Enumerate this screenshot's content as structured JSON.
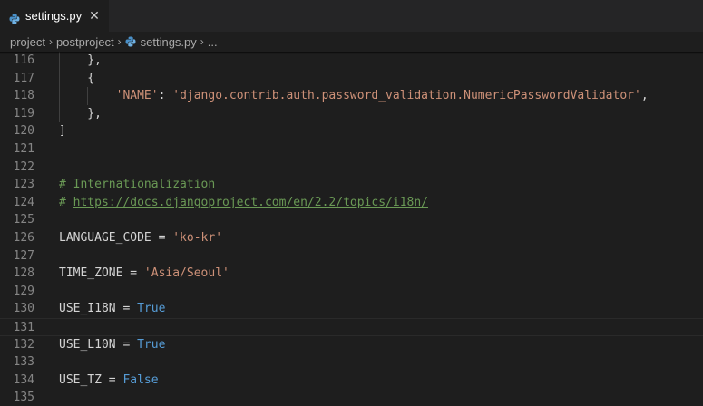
{
  "tab": {
    "label": "settings.py",
    "close": "✕",
    "icon": "python-file-icon"
  },
  "breadcrumb": {
    "items": [
      "project",
      "postproject",
      "settings.py",
      "..."
    ],
    "separator": "›"
  },
  "editor": {
    "lines": [
      {
        "num": "116",
        "tokens": [
          {
            "t": "    },",
            "c": ""
          }
        ],
        "guides": 1
      },
      {
        "num": "117",
        "tokens": [
          {
            "t": "    {",
            "c": ""
          }
        ],
        "guides": 1
      },
      {
        "num": "118",
        "tokens": [
          {
            "t": "        ",
            "c": ""
          },
          {
            "t": "'NAME'",
            "c": "t-str"
          },
          {
            "t": ": ",
            "c": ""
          },
          {
            "t": "'django.contrib.auth.password_validation.NumericPasswordValidator'",
            "c": "t-str"
          },
          {
            "t": ",",
            "c": ""
          }
        ],
        "guides": 2
      },
      {
        "num": "119",
        "tokens": [
          {
            "t": "    },",
            "c": ""
          }
        ],
        "guides": 1
      },
      {
        "num": "120",
        "tokens": [
          {
            "t": "]",
            "c": ""
          }
        ],
        "guides": 0
      },
      {
        "num": "121",
        "tokens": [],
        "guides": 0
      },
      {
        "num": "122",
        "tokens": [],
        "guides": 0
      },
      {
        "num": "123",
        "tokens": [
          {
            "t": "# Internationalization",
            "c": "t-cmt"
          }
        ],
        "guides": 0
      },
      {
        "num": "124",
        "tokens": [
          {
            "t": "# ",
            "c": "t-cmt"
          },
          {
            "t": "https://docs.djangoproject.com/en/2.2/topics/i18n/",
            "c": "t-link"
          }
        ],
        "guides": 0
      },
      {
        "num": "125",
        "tokens": [],
        "guides": 0
      },
      {
        "num": "126",
        "tokens": [
          {
            "t": "LANGUAGE_CODE = ",
            "c": ""
          },
          {
            "t": "'ko-kr'",
            "c": "t-str"
          }
        ],
        "guides": 0
      },
      {
        "num": "127",
        "tokens": [],
        "guides": 0
      },
      {
        "num": "128",
        "tokens": [
          {
            "t": "TIME_ZONE = ",
            "c": ""
          },
          {
            "t": "'Asia/Seoul'",
            "c": "t-str"
          }
        ],
        "guides": 0
      },
      {
        "num": "129",
        "tokens": [],
        "guides": 0
      },
      {
        "num": "130",
        "tokens": [
          {
            "t": "USE_I18N = ",
            "c": ""
          },
          {
            "t": "True",
            "c": "t-kw"
          }
        ],
        "guides": 0
      },
      {
        "num": "131",
        "tokens": [],
        "guides": 0,
        "current": true
      },
      {
        "num": "132",
        "tokens": [
          {
            "t": "USE_L10N = ",
            "c": ""
          },
          {
            "t": "True",
            "c": "t-kw"
          }
        ],
        "guides": 0
      },
      {
        "num": "133",
        "tokens": [],
        "guides": 0
      },
      {
        "num": "134",
        "tokens": [
          {
            "t": "USE_TZ = ",
            "c": ""
          },
          {
            "t": "False",
            "c": "t-kw"
          }
        ],
        "guides": 0
      },
      {
        "num": "135",
        "tokens": [],
        "guides": 0
      }
    ]
  },
  "colors": {
    "background": "#1e1e1e",
    "string": "#ce9178",
    "keyword": "#569cd6",
    "comment": "#6a9955",
    "line_number": "#858585"
  }
}
